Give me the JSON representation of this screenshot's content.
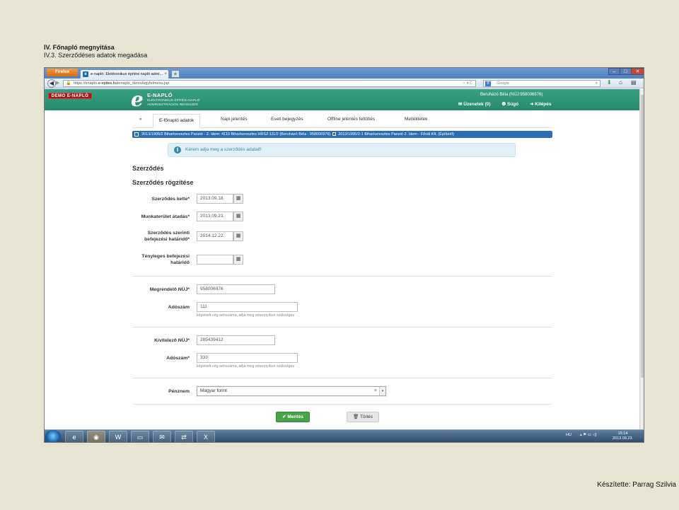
{
  "slide": {
    "title": "IV. Főnapló megnyitása",
    "subtitle": "IV.3. Szerződéses adatok megadása",
    "credits": "Készítette: Parrag Szilvia"
  },
  "browser": {
    "firefox_label": "Firefox",
    "tab_title": "e-napló: Elektronikus építési napló admi...",
    "tab_close": "×",
    "new_tab": "+",
    "url_prefix": "https://enaplo.",
    "url_domain": "e-epites.hu",
    "url_path": "/enaplo_demo/ugyfelmenu.jsp",
    "search_engine": "Google",
    "window_controls": [
      "–",
      "□",
      "✕"
    ]
  },
  "app": {
    "demo_badge": "DEMO E-NAPLÓ",
    "logo_letter": "e",
    "logo_name": "E-NAPLÓ",
    "logo_desc": "ELEKTRONIKUS ÉPÍTÉSI NAPLÓ ADMINISZTRÁCIÓS RENDSZER",
    "user": "Beruházó Béla (NÜJ:958006976)",
    "messages": "✉ Üzenetek (0)",
    "help": "❶ Súgó",
    "logout": "➜ Kilépés"
  },
  "nav": {
    "back": "«",
    "tabs": [
      "E-főnapló adatok",
      "Napi jelentés",
      "Eseti bejegyzés",
      "Offline jelentés feltöltés",
      "Mellékletek"
    ]
  },
  "breadcrumb": {
    "part1": "2013/1995/2 Biharkeresztes Panzió - 2. ütem: 4110 Biharkeresztes HRSZ:111/2 (Beruházó Béla : 958006976)",
    "part2": "2013/1995/2-1 Biharkeresztes Panzió 2. ütem - Fővál Kft. (Építtető)"
  },
  "alert": {
    "icon": "i",
    "text": "Kérem adja meg a szerződés adatait!"
  },
  "form": {
    "heading": "Szerződés",
    "subheading": "Szerződés rögzítése",
    "contract_date": {
      "label": "Szerződés kelte*",
      "value": "2013.09.18."
    },
    "site_handover": {
      "label": "Munkaterület átadás*",
      "value": "2013.09.23."
    },
    "planned_end": {
      "label_line1": "Szerződés szerinti",
      "label_line2": "befejezési határidő*",
      "value": "2014.12.22."
    },
    "actual_end": {
      "label_line1": "Tényleges befejezési",
      "label_line2": "határidő",
      "value": ""
    },
    "client_nuj": {
      "label": "Megrendelő NÜJ*",
      "value": "958006976"
    },
    "client_tax": {
      "label": "Adószám",
      "value": "111",
      "help": "képviselt cég adószáma, adja meg amennyiben szükséges"
    },
    "contractor_nuj": {
      "label": "Kivitelező NÜJ*",
      "value": "285439412"
    },
    "contractor_tax": {
      "label": "Adószám*",
      "value": "333",
      "help": "képviselt cég adószáma, adja meg amennyiben szükséges"
    },
    "currency": {
      "label": "Pénznem",
      "value": "Magyar forint",
      "clear": "×",
      "arrow": "▾"
    },
    "calendar_icon": "▦"
  },
  "buttons": {
    "save": "✔ Mentés",
    "delete": "🗑 Törlés"
  },
  "taskbar": {
    "lang": "HU",
    "time": "15:14",
    "date": "2013.09.23."
  }
}
